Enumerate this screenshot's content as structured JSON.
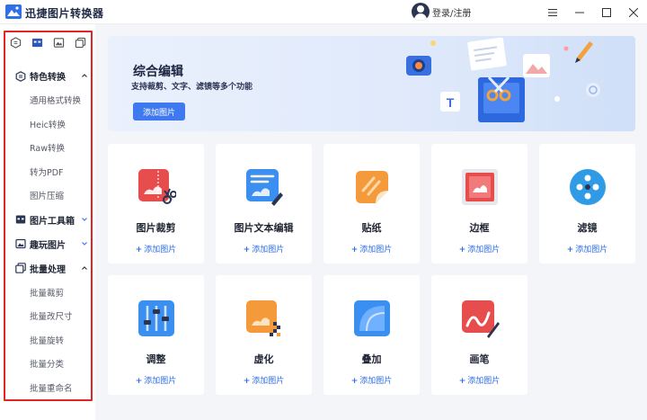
{
  "app": {
    "title": "迅捷图片转换器",
    "login_label": "登录/注册",
    "accent_color": "#3f79f0",
    "highlight_outline_color": "#e02525"
  },
  "window_controls": [
    "menu-icon",
    "minimize-icon",
    "maximize-icon",
    "close-icon"
  ],
  "sidebar": {
    "mode_tabs": [
      "hexagon-convert-icon",
      "toolbox-icon",
      "image-icon",
      "layers-icon"
    ],
    "sections": [
      {
        "label": "特色转换",
        "icon": "hexagon-convert-icon",
        "expanded": true,
        "items": [
          "通用格式转换",
          "Heic转换",
          "Raw转换",
          "转为PDF",
          "图片压缩"
        ]
      },
      {
        "label": "图片工具箱",
        "icon": "toolbox-icon",
        "expanded": false,
        "items": []
      },
      {
        "label": "趣玩图片",
        "icon": "image-icon",
        "expanded": false,
        "items": []
      },
      {
        "label": "批量处理",
        "icon": "layers-icon",
        "expanded": true,
        "items": [
          "批量裁剪",
          "批量改尺寸",
          "批量旋转",
          "批量分类",
          "批量重命名"
        ]
      }
    ]
  },
  "banner": {
    "title": "综合编辑",
    "subtitle": "支持裁剪、文字、滤镜等多个功能",
    "button_label": "添加图片"
  },
  "tools": [
    {
      "name": "图片裁剪",
      "add_label": "添加图片",
      "icon": "crop-icon",
      "color": "#e84d4d"
    },
    {
      "name": "图片文本编辑",
      "add_label": "添加图片",
      "icon": "text-edit-icon",
      "color": "#3a8ff0"
    },
    {
      "name": "贴纸",
      "add_label": "添加图片",
      "icon": "sticker-icon",
      "color": "#f59a3a"
    },
    {
      "name": "边框",
      "add_label": "添加图片",
      "icon": "frame-icon",
      "color": "#e84d4d"
    },
    {
      "name": "滤镜",
      "add_label": "添加图片",
      "icon": "filter-icon",
      "color": "#2f9ae6"
    },
    {
      "name": "调整",
      "add_label": "添加图片",
      "icon": "adjust-icon",
      "color": "#3a8ff0"
    },
    {
      "name": "虚化",
      "add_label": "添加图片",
      "icon": "blur-icon",
      "color": "#f59a3a"
    },
    {
      "name": "叠加",
      "add_label": "添加图片",
      "icon": "overlay-icon",
      "color": "#3a8ff0"
    },
    {
      "name": "画笔",
      "add_label": "添加图片",
      "icon": "brush-icon",
      "color": "#e84d4d"
    }
  ]
}
